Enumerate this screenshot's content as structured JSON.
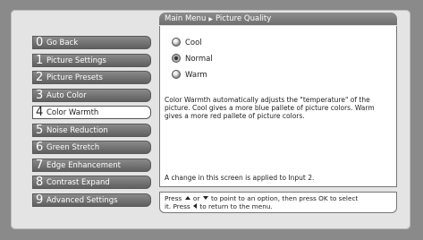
{
  "breadcrumb": {
    "root": "Main Menu",
    "current": "Picture Quality"
  },
  "menu": {
    "items": [
      {
        "num": "0",
        "label": "Go Back"
      },
      {
        "num": "1",
        "label": "Picture Settings"
      },
      {
        "num": "2",
        "label": "Picture Presets"
      },
      {
        "num": "3",
        "label": "Auto Color"
      },
      {
        "num": "4",
        "label": "Color Warmth"
      },
      {
        "num": "5",
        "label": "Noise Reduction"
      },
      {
        "num": "6",
        "label": "Green Stretch"
      },
      {
        "num": "7",
        "label": "Edge Enhancement"
      },
      {
        "num": "8",
        "label": "Contrast Expand"
      },
      {
        "num": "9",
        "label": "Advanced Settings"
      }
    ],
    "selected": "Color Warmth"
  },
  "options": [
    {
      "label": "Cool",
      "selected": false
    },
    {
      "label": "Normal",
      "selected": true
    },
    {
      "label": "Warm",
      "selected": false
    }
  ],
  "description": "Color Warmth automatically adjusts the \"temperature\" of the picture. Cool gives a more blue pallete of picture colors. Warm gives a more red pallete of picture colors.",
  "note": "A change in this screen is applied to Input 2.",
  "help": {
    "line1_a": "Press",
    "line1_b": "or",
    "line1_c": "to point to an option, then press OK to select",
    "line2_a": "it. Press",
    "line2_b": "to return to the menu."
  },
  "icons": {
    "breadcrumb_separator": "triangle-right-icon",
    "option_marker": "radio-icon"
  }
}
